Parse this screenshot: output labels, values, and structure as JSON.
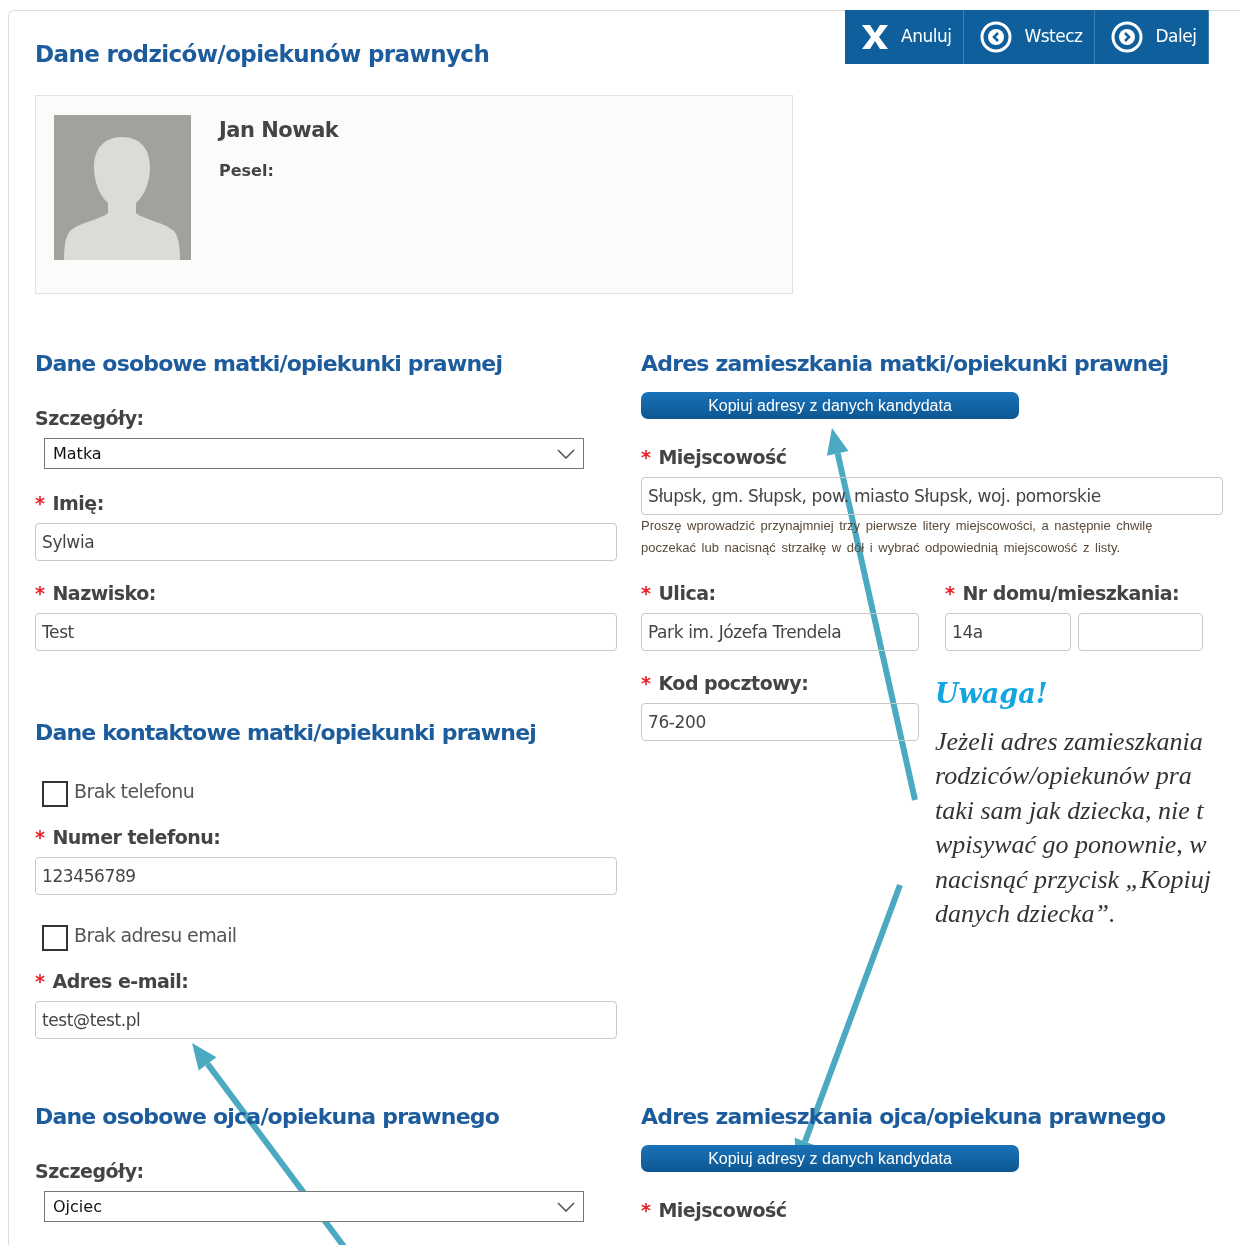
{
  "header": {
    "title": "Dane rodziców/opiekunów prawnych"
  },
  "toolbar": [
    {
      "kind": "cancel",
      "label": "Anuluj"
    },
    {
      "kind": "back",
      "label": "Wstecz"
    },
    {
      "kind": "next",
      "label": "Dalej"
    }
  ],
  "candidate": {
    "name": "Jan Nowak",
    "pesel_label": "Pesel:"
  },
  "mother": {
    "personal": {
      "title": "Dane osobowe matki/opiekunki prawnej",
      "fields": [
        {
          "kind": "select",
          "label": "Szczegóły:",
          "value": "Matka"
        },
        {
          "kind": "text",
          "marker": "*",
          "label": "Imię:",
          "value": "Sylwia"
        },
        {
          "kind": "text",
          "marker": "*",
          "label": "Nazwisko:",
          "value": "Test"
        }
      ]
    },
    "contact": {
      "title": "Dane kontaktowe matki/opiekunki prawnej",
      "fields": [
        {
          "kind": "checkbox",
          "label": "Brak telefonu",
          "checked": false
        },
        {
          "kind": "text",
          "marker": "*",
          "label": "Numer telefonu:",
          "value": "123456789"
        },
        {
          "kind": "checkbox",
          "label": "Brak adresu email",
          "checked": false
        },
        {
          "kind": "text",
          "marker": "*",
          "label": "Adres e-mail:",
          "value": "test@test.pl"
        }
      ]
    },
    "address": {
      "title": "Adres zamieszkania matki/opiekunki prawnej",
      "copy_button": "Kopiuj adresy z danych kandydata",
      "fields": [
        {
          "marker": "*",
          "label": "Miejscowość",
          "value": "Słupsk, gm. Słupsk, pow. miasto Słupsk, woj. pomorskie",
          "hint": "Proszę wprowadzić przynajmniej trzy pierwsze litery miejscowości, a następnie chwilę poczekać lub nacisnąć strzałkę w dół i wybrać odpowiednią miejscowość z listy."
        },
        {
          "marker": "*",
          "label": "Ulica:",
          "value": "Park im. Józefa Trendela"
        },
        {
          "marker": "*",
          "label": "Nr domu/mieszkania:",
          "value": "14a"
        },
        {
          "marker": "*",
          "label": "Kod pocztowy:",
          "value": "76-200"
        }
      ]
    }
  },
  "note": {
    "title": "Uwaga!",
    "lines": [
      "Jeżeli adres zamieszkania",
      "rodziców/opiekunów pra",
      "taki sam jak dziecka, nie t",
      "wpisywać go ponownie, w",
      "nacisnąć przycisk „Kopiuj",
      "danych dziecka”."
    ]
  },
  "father": {
    "personal": {
      "title": "Dane osobowe ojca/opiekuna prawnego",
      "fields": [
        {
          "kind": "select",
          "label": "Szczegóły:",
          "value": "Ojciec"
        }
      ]
    },
    "address": {
      "title": "Adres zamieszkania ojca/opiekuna prawnego",
      "copy_button": "Kopiuj adresy z danych kandydata",
      "fields": [
        {
          "marker": "*",
          "label": "Miejscowość"
        }
      ]
    }
  },
  "annotations": [
    {
      "kind": "arrow"
    },
    {
      "kind": "arrow"
    },
    {
      "kind": "arrow"
    }
  ]
}
